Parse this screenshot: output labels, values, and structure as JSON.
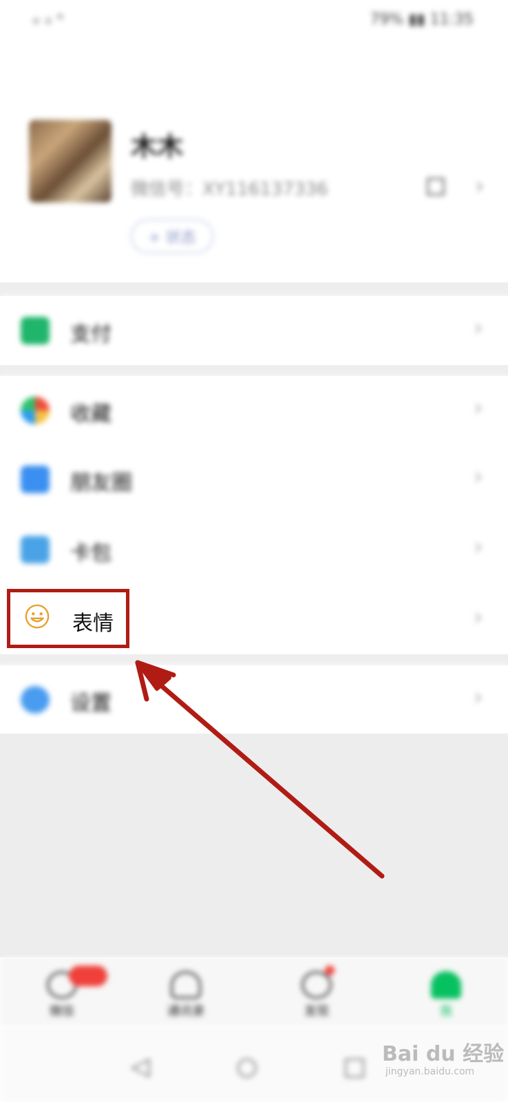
{
  "status_bar": {
    "signal": "ᵢₗ ᵢₗ ⁿ",
    "right": "79% ▮▮ 11:35"
  },
  "profile": {
    "nickname": "木木",
    "wechat_id": "微信号：XY116137336",
    "status_button": "+ 状态"
  },
  "menu": {
    "pay": "支付",
    "favorites": "收藏",
    "moments": "朋友圈",
    "cards": "卡包",
    "stickers": "表情",
    "settings": "设置"
  },
  "tabs": {
    "chats": "微信",
    "contacts": "通讯录",
    "discover": "发现",
    "me": "我"
  },
  "watermark": {
    "main": "Bai du 经验",
    "sub": "jingyan.baidu.com"
  },
  "colors": {
    "highlight": "#b01c14",
    "accent_green": "#07c160",
    "badge": "#f0403a",
    "sticker_icon": "#e8a030"
  }
}
